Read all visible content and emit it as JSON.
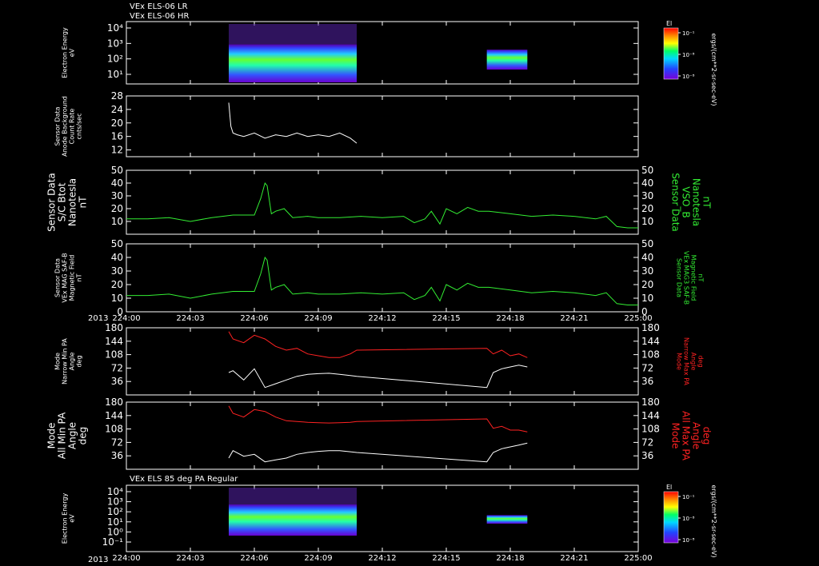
{
  "header": {
    "line1": "VEx ELS-06 LR",
    "line2": "VEx ELS-06 HR",
    "panel7_title": "VEx ELS 85 deg PA Regular"
  },
  "x_axis": {
    "year": "2013",
    "ticks": [
      "224:00",
      "224:03",
      "224:06",
      "224:09",
      "224:12",
      "224:15",
      "224:18",
      "224:21",
      "225:00"
    ]
  },
  "colors": {
    "background": "#000000",
    "axes": "#ffffff",
    "green": "#33ee33",
    "red": "#ff2222",
    "white": "#ffffff"
  },
  "colorbars": [
    {
      "label": "El",
      "ticks": [
        "10⁻¹",
        "10⁻⁸",
        "10⁻⁸"
      ]
    },
    {
      "label": "El",
      "ticks": [
        "10⁻¹",
        "10⁻⁸",
        "10⁻⁸"
      ]
    }
  ],
  "cb_unit": "ergs/(cm**2-sr-sec-eV)",
  "chart_data": [
    {
      "type": "heatmap",
      "ylabel": [
        "Electron Energy",
        "eV"
      ],
      "yticks": [
        "10⁴",
        "10³",
        "10²",
        "10¹"
      ],
      "blocks": [
        {
          "t0": 4.8,
          "t1": 10.8,
          "note": "broad energy spectrum, peak ~10-100 eV"
        },
        {
          "t0": 16.9,
          "t1": 18.8,
          "note": "narrow band ~10-100 eV"
        }
      ]
    },
    {
      "type": "line",
      "ylabel": [
        "Sensor Data",
        "Anode Background",
        "Count Rate",
        "cnts/sec"
      ],
      "ylim": [
        10,
        28
      ],
      "yticks": [
        "28",
        "24",
        "20",
        "16",
        "12"
      ],
      "series": [
        {
          "color": "white",
          "x": [
            4.8,
            4.9,
            5.0,
            5.2,
            5.5,
            6.0,
            6.5,
            7.0,
            7.5,
            8.0,
            8.5,
            9.0,
            9.5,
            10.0,
            10.5,
            10.8
          ],
          "y": [
            26,
            19,
            17,
            16.5,
            16,
            17,
            15.5,
            16.5,
            16,
            17,
            16,
            16.5,
            16,
            17,
            15.5,
            14
          ]
        }
      ]
    },
    {
      "type": "line",
      "ylabel": [
        "Sensor Data",
        "S/C Btot",
        "Nanotesla",
        "nT"
      ],
      "ylabel_right": [
        "Sensor Data",
        "VSO_B",
        "Nanotesla",
        "nT"
      ],
      "ylim": [
        0,
        50
      ],
      "yticks": [
        "50",
        "40",
        "30",
        "20",
        "10"
      ],
      "series": [
        {
          "color": "green",
          "x": [
            0,
            1,
            2,
            3,
            4,
            5,
            6.0,
            6.3,
            6.5,
            6.6,
            6.8,
            7.0,
            7.4,
            7.8,
            8.5,
            9,
            10,
            11,
            12,
            13,
            13.5,
            14,
            14.3,
            14.7,
            15,
            15.5,
            16,
            16.5,
            17,
            18,
            19,
            20,
            21,
            22,
            22.5,
            23,
            23.5,
            24
          ],
          "y": [
            12,
            12,
            13,
            10,
            13,
            15,
            15,
            28,
            40,
            38,
            16,
            18,
            20,
            13,
            14,
            13,
            13,
            14,
            13,
            14,
            9,
            12,
            18,
            8,
            20,
            16,
            21,
            18,
            18,
            16,
            14,
            15,
            14,
            12,
            14,
            6,
            5,
            5
          ]
        }
      ]
    },
    {
      "type": "line",
      "ylabel": [
        "Sensor Data",
        "VEx MAG SAF-B",
        "Magnetic Field",
        "nT"
      ],
      "ylabel_right": [
        "Sensor Data",
        "VEx MAG3 SAF-B",
        "Magnetic Field",
        "nT"
      ],
      "ylim": [
        0,
        50
      ],
      "yticks": [
        "50",
        "40",
        "30",
        "20",
        "10",
        "0"
      ],
      "series": [
        {
          "color": "green",
          "x": [
            0,
            1,
            2,
            3,
            4,
            5,
            6.0,
            6.3,
            6.5,
            6.6,
            6.8,
            7.0,
            7.4,
            7.8,
            8.5,
            9,
            10,
            11,
            12,
            13,
            13.5,
            14,
            14.3,
            14.7,
            15,
            15.5,
            16,
            16.5,
            17,
            18,
            19,
            20,
            21,
            22,
            22.5,
            23,
            23.5,
            24
          ],
          "y": [
            12,
            12,
            13,
            10,
            13,
            15,
            15,
            28,
            40,
            38,
            16,
            18,
            20,
            13,
            14,
            13,
            13,
            14,
            13,
            14,
            9,
            12,
            18,
            8,
            20,
            16,
            21,
            18,
            18,
            16,
            14,
            15,
            14,
            12,
            14,
            6,
            5,
            5
          ]
        }
      ]
    },
    {
      "type": "line",
      "ylabel": [
        "Mode",
        "Narrow Min PA",
        "Angle",
        "deg"
      ],
      "ylabel_right": [
        "Mode",
        "Narrow Max PA",
        "Angle",
        "deg"
      ],
      "ylim": [
        0,
        180
      ],
      "yticks": [
        "180",
        "144",
        "108",
        "72",
        "36"
      ],
      "series": [
        {
          "color": "red",
          "x": [
            4.8,
            5.0,
            5.5,
            6.0,
            6.5,
            7.0,
            7.5,
            8.0,
            8.5,
            9.0,
            9.5,
            10.0,
            10.5,
            10.8,
            16.9,
            17.2,
            17.6,
            18.0,
            18.4,
            18.8
          ],
          "y": [
            170,
            150,
            140,
            160,
            150,
            130,
            120,
            125,
            110,
            105,
            100,
            100,
            110,
            120,
            125,
            110,
            120,
            105,
            110,
            100
          ]
        },
        {
          "color": "white",
          "x": [
            4.8,
            5.0,
            5.5,
            6.0,
            6.5,
            7.0,
            7.5,
            8.0,
            8.5,
            9.0,
            9.5,
            10.0,
            10.5,
            10.8,
            16.9,
            17.2,
            17.6,
            18.0,
            18.4,
            18.8
          ],
          "y": [
            60,
            65,
            40,
            70,
            20,
            30,
            40,
            50,
            55,
            57,
            58,
            55,
            52,
            50,
            20,
            60,
            70,
            75,
            80,
            75
          ]
        }
      ]
    },
    {
      "type": "line",
      "ylabel": [
        "Mode",
        "All Min PA",
        "Angle",
        "deg"
      ],
      "ylabel_right": [
        "Mode",
        "All Max PA",
        "Angle",
        "deg"
      ],
      "ylim": [
        0,
        180
      ],
      "yticks": [
        "180",
        "144",
        "108",
        "72",
        "36"
      ],
      "series": [
        {
          "color": "red",
          "x": [
            4.8,
            5.0,
            5.5,
            6.0,
            6.5,
            7.0,
            7.5,
            8.0,
            8.5,
            9.0,
            9.5,
            10.0,
            10.5,
            10.8,
            16.9,
            17.2,
            17.6,
            18.0,
            18.4,
            18.8
          ],
          "y": [
            170,
            150,
            140,
            160,
            155,
            140,
            130,
            128,
            126,
            125,
            124,
            125,
            126,
            128,
            135,
            110,
            115,
            105,
            105,
            100
          ]
        },
        {
          "color": "white",
          "x": [
            4.8,
            5.0,
            5.5,
            6.0,
            6.5,
            7.0,
            7.5,
            8.0,
            8.5,
            9.0,
            9.5,
            10.0,
            10.5,
            10.8,
            16.9,
            17.2,
            17.6,
            18.0,
            18.4,
            18.8
          ],
          "y": [
            30,
            50,
            35,
            40,
            20,
            25,
            30,
            40,
            45,
            48,
            50,
            50,
            47,
            45,
            20,
            45,
            55,
            60,
            65,
            70
          ]
        }
      ]
    },
    {
      "type": "heatmap",
      "ylabel": [
        "Electron Energy",
        "eV"
      ],
      "yticks": [
        "10⁴",
        "10³",
        "10²",
        "10¹",
        "10⁰",
        "10⁻¹"
      ],
      "blocks": [
        {
          "t0": 4.8,
          "t1": 10.8,
          "note": "band ~10-100 eV, gaps near 224:06"
        },
        {
          "t0": 16.9,
          "t1": 18.8,
          "note": "narrow band ~10-100 eV"
        }
      ]
    }
  ]
}
